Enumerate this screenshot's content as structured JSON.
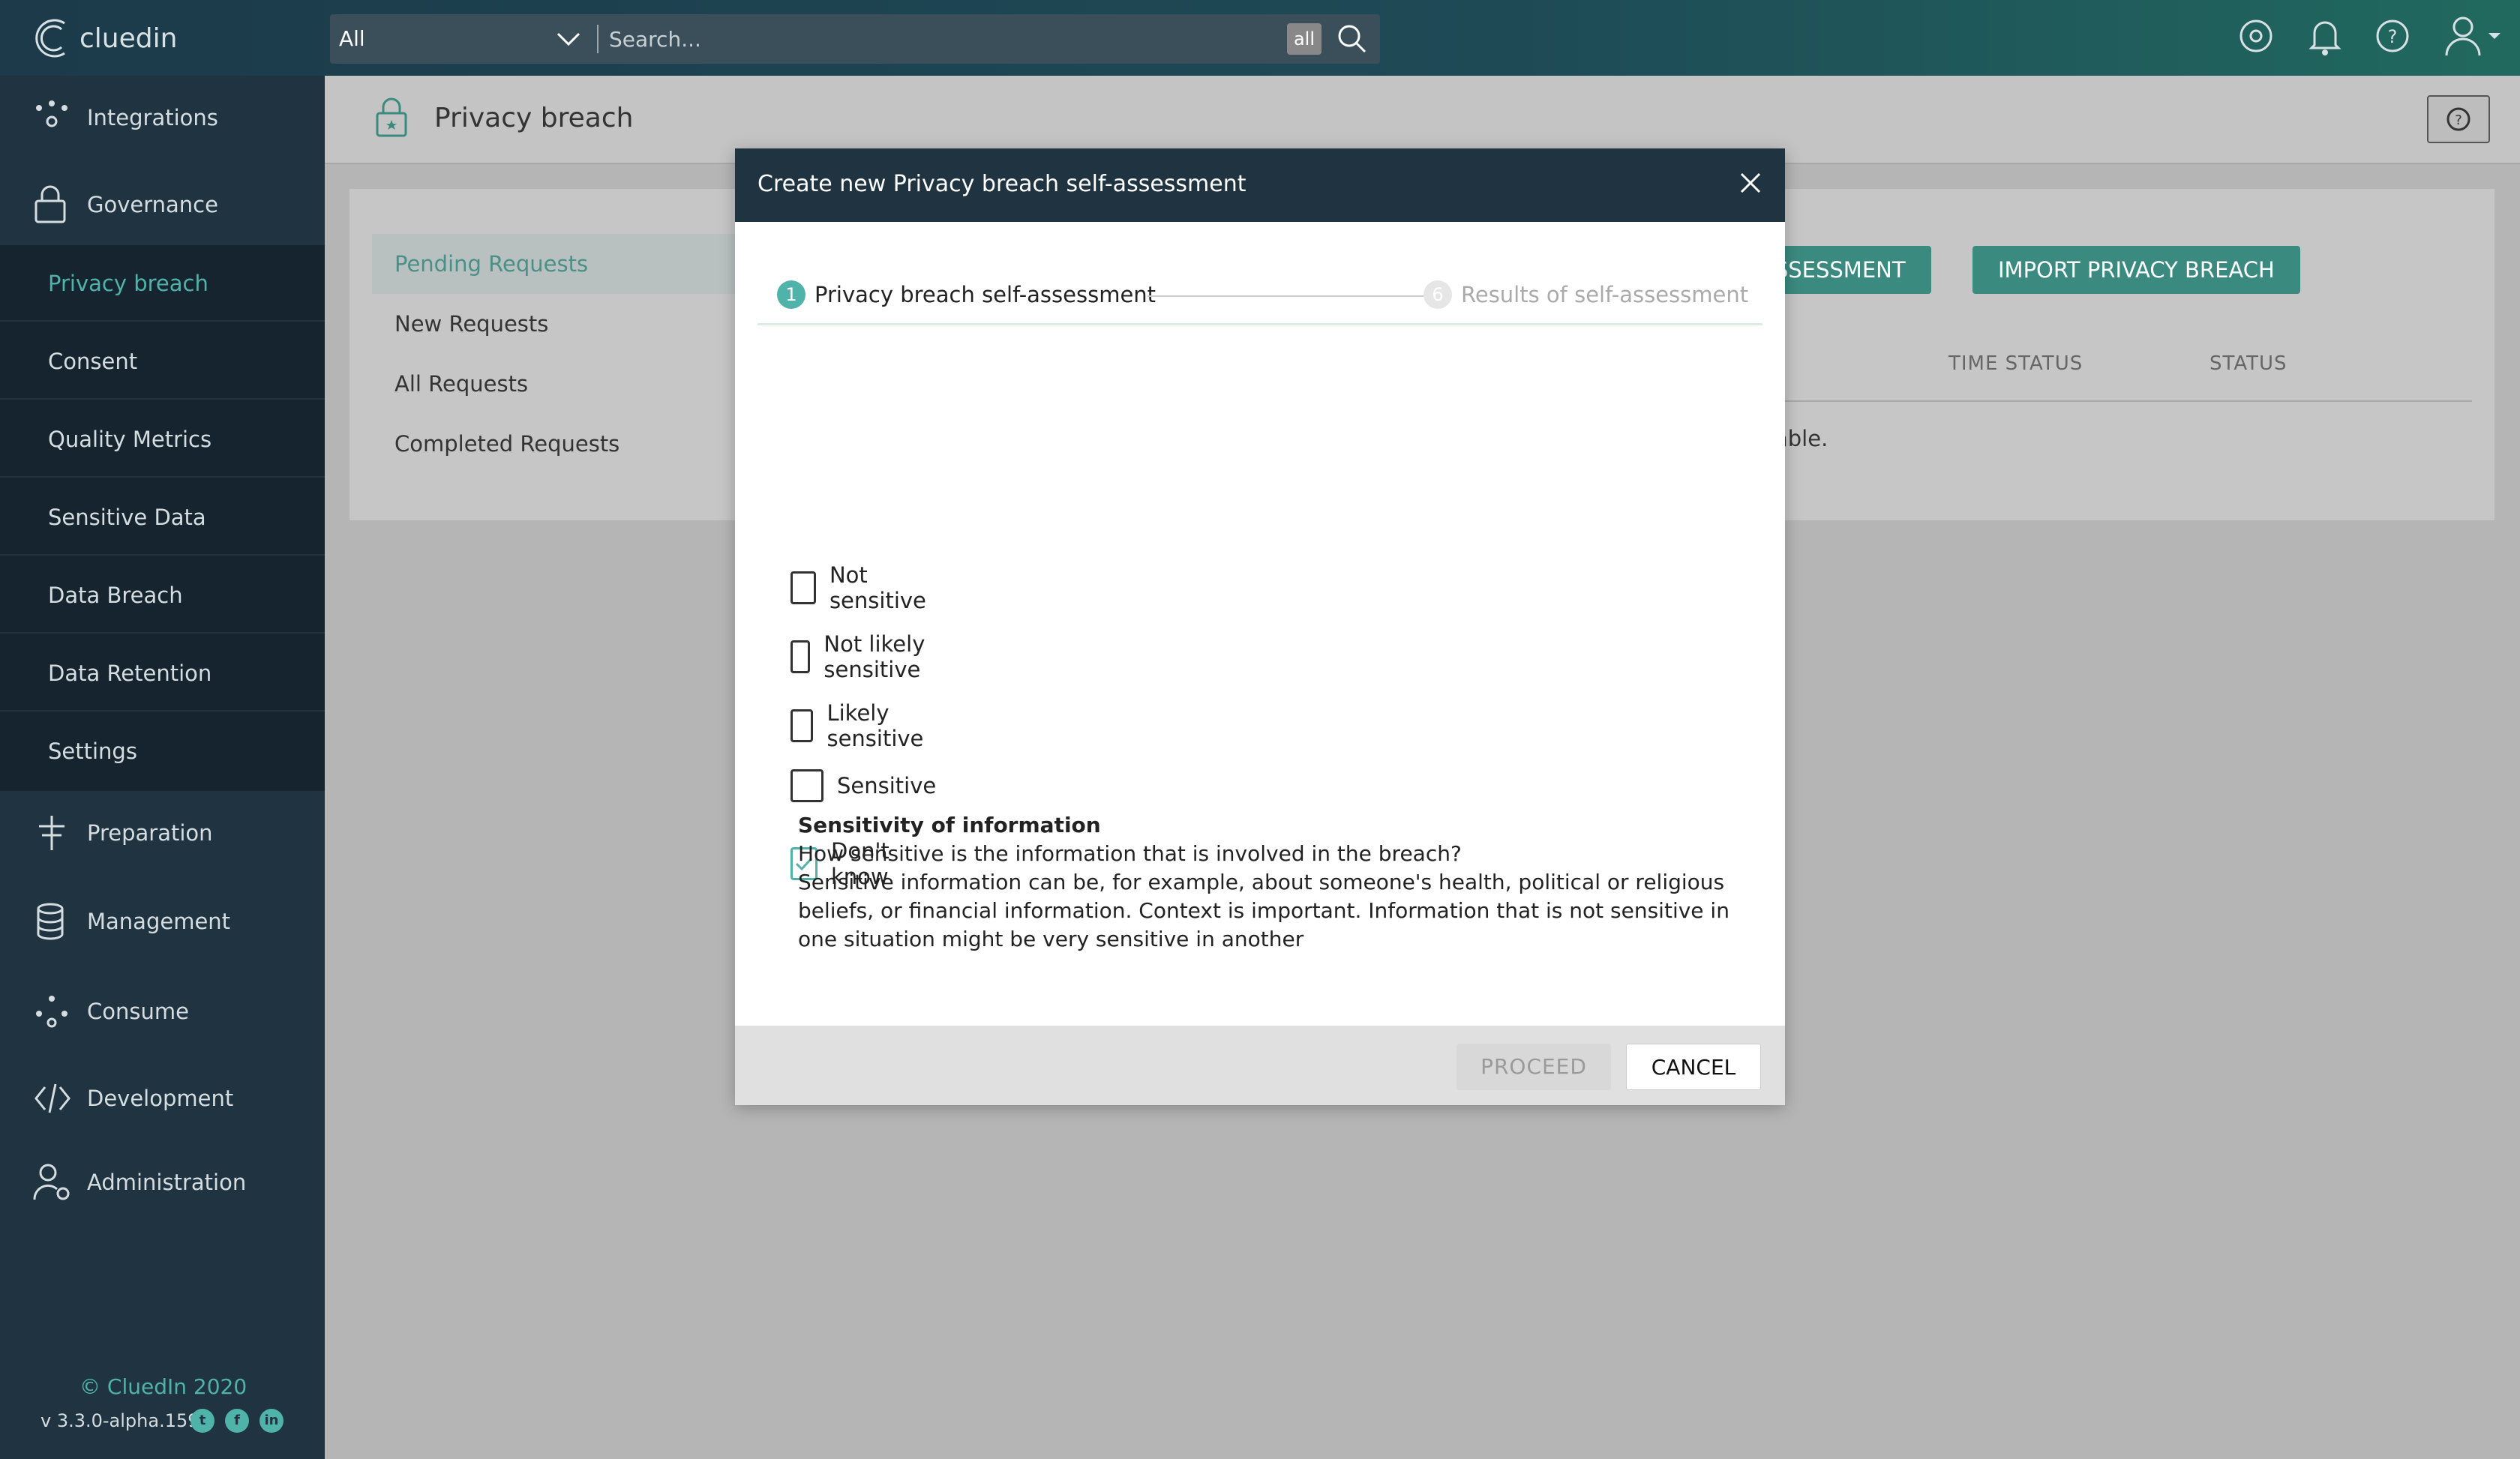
{
  "app": {
    "logo_text": "cluedin"
  },
  "search": {
    "scope": "All",
    "placeholder": "Search...",
    "badge": "all"
  },
  "sidebar": {
    "items": [
      {
        "label": "Integrations",
        "icon": "integrations-icon"
      },
      {
        "label": "Governance",
        "icon": "lock-icon"
      },
      {
        "label": "Preparation",
        "icon": "preparation-icon"
      },
      {
        "label": "Management",
        "icon": "database-icon"
      },
      {
        "label": "Consume",
        "icon": "consume-icon"
      },
      {
        "label": "Development",
        "icon": "code-icon"
      },
      {
        "label": "Administration",
        "icon": "admin-user-icon"
      }
    ],
    "governance_sub": [
      {
        "label": "Privacy breach",
        "active": true
      },
      {
        "label": "Consent"
      },
      {
        "label": "Quality Metrics"
      },
      {
        "label": "Sensitive Data"
      },
      {
        "label": "Data Breach"
      },
      {
        "label": "Data Retention"
      },
      {
        "label": "Settings"
      }
    ],
    "footer": {
      "copyright": "©  CluedIn  2020",
      "version": "v 3.3.0-alpha.159"
    }
  },
  "page": {
    "title": "Privacy breach",
    "tabs": [
      "Pending Requests",
      "New Requests",
      "All Requests",
      "Completed Requests"
    ],
    "buttons": {
      "assessment": "ASSESSMENT",
      "import": "IMPORT PRIVACY BREACH"
    },
    "columns": [
      "TIME STATUS",
      "STATUS"
    ],
    "empty_text": "able."
  },
  "modal": {
    "title": "Create new Privacy breach self-assessment",
    "steps": [
      {
        "num": "1",
        "label": "Privacy breach self-assessment"
      },
      {
        "num": "6",
        "label": "Results of self-assessment"
      }
    ],
    "options": [
      {
        "label": "Not sensitive",
        "checked": false
      },
      {
        "label": "Not likely sensitive",
        "checked": false
      },
      {
        "label": "Likely sensitive",
        "checked": false
      },
      {
        "label": "Sensitive",
        "checked": false
      },
      {
        "label": "Don't know",
        "checked": true
      }
    ],
    "info": {
      "title": "Sensitivity of information",
      "line1": "How sensitive is the information that is involved in the breach?",
      "line2": "Sensitive information can be, for example, about someone's health, political or religious beliefs, or financial information. Context is important. Information that is not sensitive in one situation might be very sensitive in another"
    },
    "proceed": "PROCEED",
    "cancel": "CANCEL"
  },
  "colors": {
    "accent": "#4fb3a9",
    "sidebar": "#1f3340",
    "button": "#3b8a7f"
  }
}
